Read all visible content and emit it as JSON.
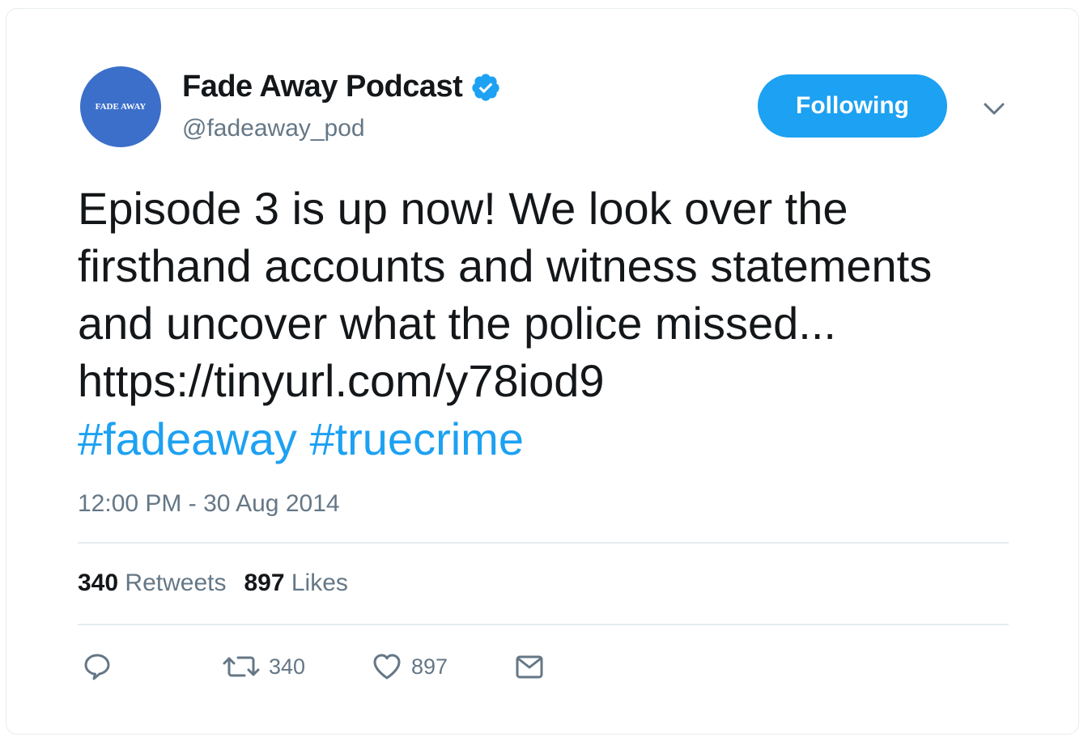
{
  "user": {
    "avatar_text": "FADE AWAY",
    "display_name": "Fade Away Podcast",
    "handle": "@fadeaway_pod",
    "verified": true
  },
  "follow_button": {
    "label": "Following"
  },
  "tweet": {
    "text": "Episode 3 is up now! We look over the firsthand accounts and witness statements and uncover what the police missed... https://tinyurl.com/y78iod9",
    "hashtags": [
      "#fadeaway",
      "#truecrime"
    ],
    "timestamp": "12:00 PM - 30 Aug 2014"
  },
  "stats": {
    "retweets_count": "340",
    "retweets_label": "Retweets",
    "likes_count": "897",
    "likes_label": "Likes"
  },
  "actions": {
    "reply_icon": "reply-icon",
    "retweet_icon": "retweet-icon",
    "retweet_count": "340",
    "like_icon": "heart-icon",
    "like_count": "897",
    "dm_icon": "envelope-icon"
  },
  "colors": {
    "accent": "#1da1f2",
    "text_primary": "#14171a",
    "text_secondary": "#657786",
    "avatar_bg": "#3b6fc9",
    "divider": "#e6ecf0"
  }
}
